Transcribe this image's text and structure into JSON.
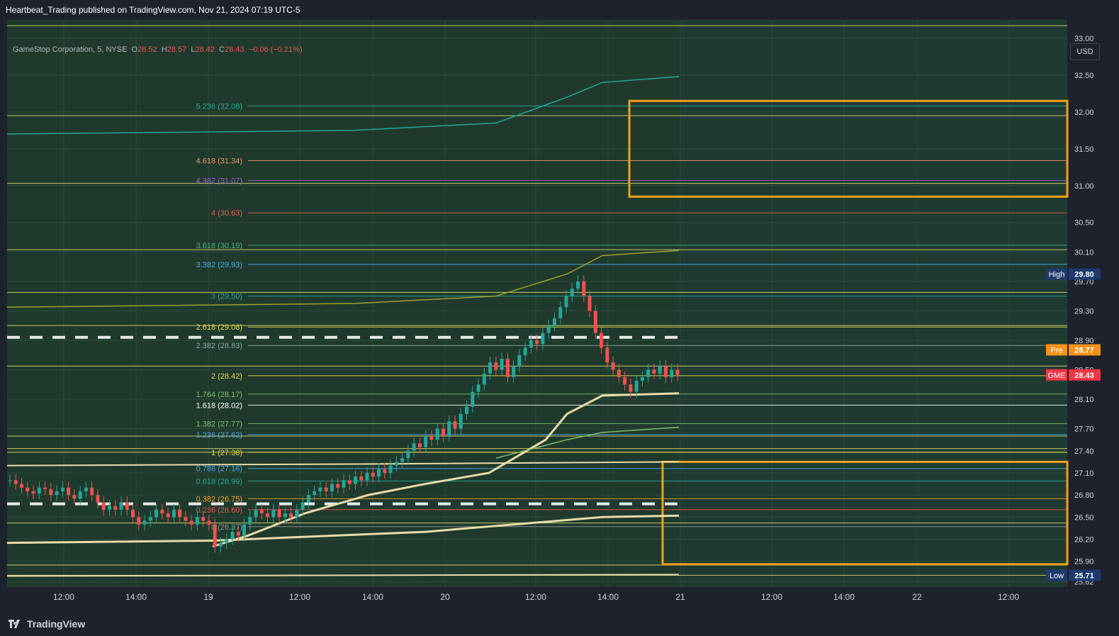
{
  "header": {
    "text": "Heartbeat_Trading published on TradingView.com, Nov 21, 2024 07:19 UTC-5"
  },
  "legend": {
    "symbol": "GameStop Corporation, 5, NYSE",
    "o_label": "O",
    "o": "28.52",
    "h_label": "H",
    "h": "28.57",
    "l_label": "L",
    "l": "28.42",
    "c_label": "C",
    "c": "28.43",
    "chg": "−0.06 (−0.21%)"
  },
  "currency": "USD",
  "footer": {
    "brand": "TradingView"
  },
  "colors": {
    "background_plot": "#1f3a2c",
    "background_future": "#1f3b31",
    "candle_up": "#26a69a",
    "candle_down": "#ef5350",
    "vwap": "#e8dcaa",
    "box": "#f0a020",
    "text": "#d1d4dc"
  },
  "chart_data": {
    "type": "candlestick",
    "symbol": "GME",
    "interval": "5",
    "ylim": [
      25.55,
      33.25
    ],
    "y_ticks": [
      "33.00",
      "32.50",
      "32.00",
      "31.50",
      "31.00",
      "30.50",
      "30.10",
      "29.70",
      "29.30",
      "28.90",
      "28.50",
      "28.10",
      "27.70",
      "27.40",
      "27.10",
      "26.80",
      "26.50",
      "26.20",
      "25.90",
      "25.62"
    ],
    "x_ticks": [
      "12:00",
      "14:00",
      "19",
      "12:00",
      "14:00",
      "20",
      "12:00",
      "14:00",
      "21",
      "12:00",
      "14:00",
      "22",
      "12:00"
    ],
    "price_labels": [
      {
        "tag": "High",
        "value": "29.80",
        "color": "#1e3a6e"
      },
      {
        "tag": "Pre",
        "value": "28.77",
        "color": "#f7931a"
      },
      {
        "tag": "GME",
        "value": "28.43",
        "color": "#f23645"
      },
      {
        "tag": "Low",
        "value": "25.71",
        "color": "#1e3a6e"
      }
    ],
    "fib_levels": [
      {
        "ratio": "5.236",
        "price": "32.08",
        "color": "#26a69a"
      },
      {
        "ratio": "4.618",
        "price": "31.34",
        "color": "#f0936b"
      },
      {
        "ratio": "4.382",
        "price": "31.07",
        "color": "#9c5fd6"
      },
      {
        "ratio": "4",
        "price": "30.63",
        "color": "#e05a50"
      },
      {
        "ratio": "3.618",
        "price": "30.19",
        "color": "#4caf7a"
      },
      {
        "ratio": "3.382",
        "price": "29.93",
        "color": "#4ea8ee"
      },
      {
        "ratio": "3",
        "price": "29.50",
        "color": "#26a69a"
      },
      {
        "ratio": "2.618",
        "price": "29.08",
        "color": "#e8d94a"
      },
      {
        "ratio": "2.382",
        "price": "28.83",
        "color": "#8fa5a0"
      },
      {
        "ratio": "2",
        "price": "28.42",
        "color": "#e8d94a"
      },
      {
        "ratio": "1.764",
        "price": "28.17",
        "color": "#7fbf6a"
      },
      {
        "ratio": "1.618",
        "price": "28.02",
        "color": "#ffffff"
      },
      {
        "ratio": "1.382",
        "price": "27.77",
        "color": "#7fbf6a"
      },
      {
        "ratio": "1.236",
        "price": "27.62",
        "color": "#4ea8ee"
      },
      {
        "ratio": "1",
        "price": "27.38",
        "color": "#e8d94a"
      },
      {
        "ratio": "0.786",
        "price": "27.16",
        "color": "#4ea8ee"
      },
      {
        "ratio": "0.618",
        "price": "26.99",
        "color": "#26a69a"
      },
      {
        "ratio": "0.382",
        "price": "26.75",
        "color": "#f0a020"
      },
      {
        "ratio": "0.236",
        "price": "26.60",
        "color": "#e05a50"
      },
      {
        "ratio": "0",
        "price": "26.37",
        "color": "#8a8f98"
      }
    ],
    "horizontal_lines": [
      33.17,
      31.95,
      31.03,
      30.13,
      29.55,
      29.1,
      28.55,
      27.6,
      27.43,
      27.38,
      26.42,
      25.85,
      25.71
    ],
    "zones": [
      {
        "top": 32.15,
        "bottom": 30.85
      },
      {
        "top": 27.25,
        "bottom": 25.86
      }
    ],
    "dashed_levels": [
      28.94,
      26.68
    ],
    "candle_closes": [
      27.0,
      26.95,
      26.9,
      26.85,
      26.82,
      26.9,
      26.88,
      26.8,
      26.85,
      26.9,
      26.8,
      26.75,
      26.85,
      26.9,
      26.8,
      26.7,
      26.6,
      26.65,
      26.6,
      26.7,
      26.6,
      26.5,
      26.4,
      26.45,
      26.5,
      26.6,
      26.55,
      26.5,
      26.6,
      26.5,
      26.45,
      26.4,
      26.5,
      26.45,
      26.4,
      26.1,
      26.15,
      26.2,
      26.3,
      26.25,
      26.4,
      26.5,
      26.6,
      26.55,
      26.5,
      26.6,
      26.5,
      26.55,
      26.5,
      26.6,
      26.7,
      26.8,
      26.85,
      26.9,
      26.85,
      26.95,
      26.9,
      27.0,
      26.95,
      27.05,
      27.0,
      27.1,
      27.05,
      27.15,
      27.1,
      27.2,
      27.25,
      27.3,
      27.4,
      27.5,
      27.45,
      27.6,
      27.55,
      27.7,
      27.6,
      27.8,
      27.7,
      27.9,
      28.0,
      28.2,
      28.3,
      28.45,
      28.6,
      28.5,
      28.65,
      28.4,
      28.55,
      28.7,
      28.8,
      28.9,
      28.85,
      29.0,
      29.1,
      29.2,
      29.35,
      29.5,
      29.6,
      29.7,
      29.5,
      29.3,
      29.0,
      28.8,
      28.6,
      28.5,
      28.4,
      28.3,
      28.2,
      28.35,
      28.4,
      28.5,
      28.45,
      28.55,
      28.4,
      28.5,
      28.43
    ]
  }
}
